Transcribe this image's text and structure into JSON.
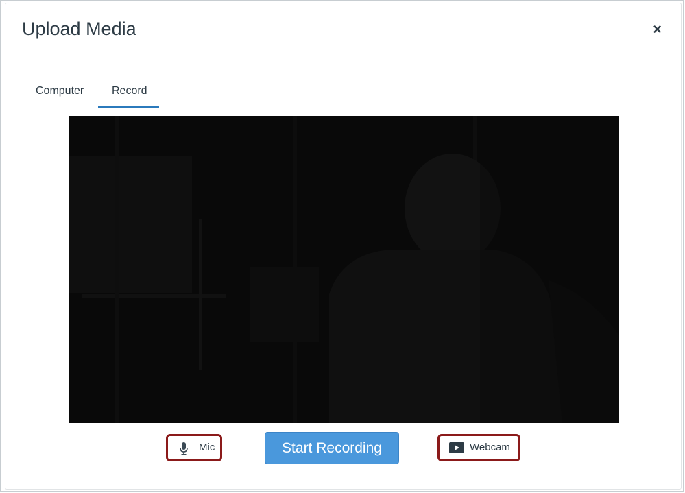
{
  "dialog": {
    "title": "Upload Media",
    "close_symbol": "×"
  },
  "tabs": [
    {
      "label": "Computer",
      "selected": false
    },
    {
      "label": "Record",
      "selected": true
    }
  ],
  "preview": {
    "content": "webcam-preview"
  },
  "controls": {
    "mic_label": "Mic",
    "mic_icon": "microphone-icon",
    "record_label": "Start Recording",
    "webcam_label": "Webcam",
    "webcam_icon": "video-play-icon"
  },
  "colors": {
    "accent": "#2b7abc",
    "primary_button": "#4a98dc",
    "highlight_outline": "#8b1a1a",
    "text": "#2d3b45"
  }
}
